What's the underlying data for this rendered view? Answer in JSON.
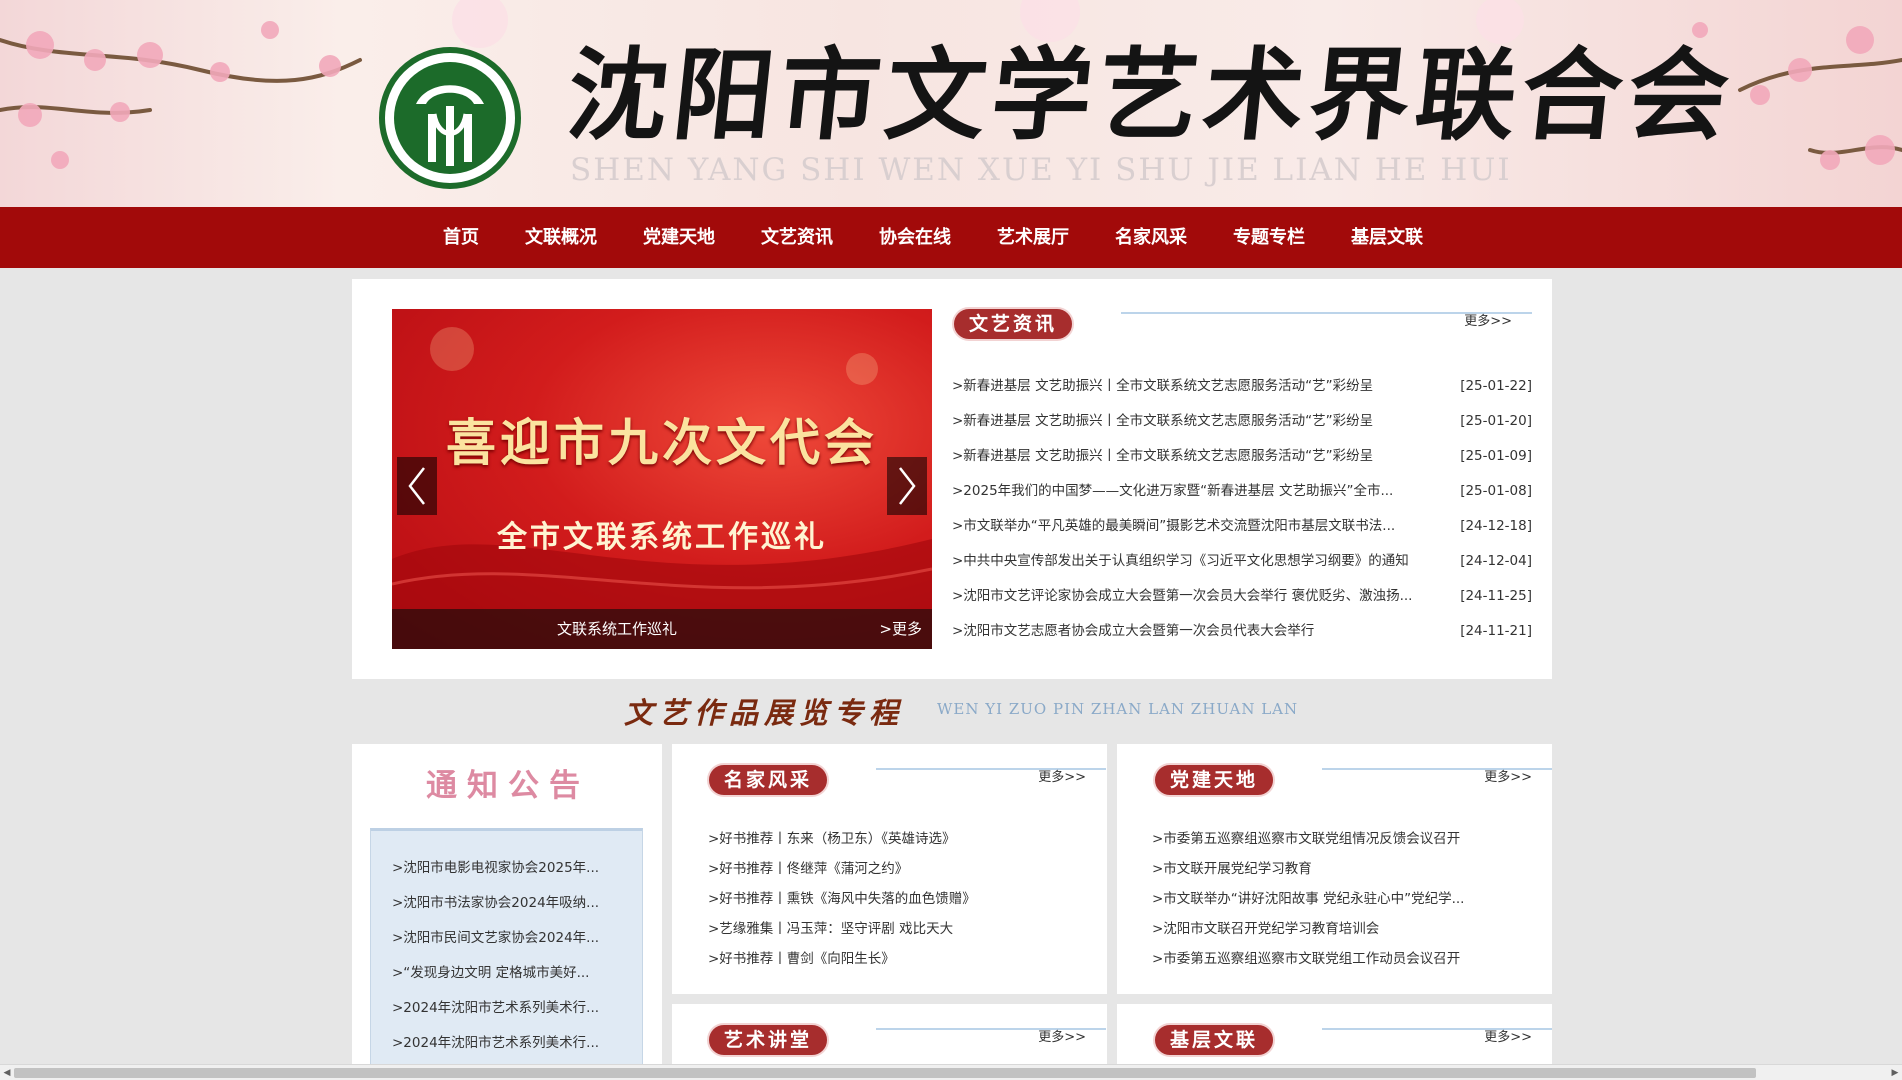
{
  "header": {
    "title": "沈阳市文学艺术界联合会",
    "pinyin": "SHEN YANG SHI WEN XUE YI SHU JIE LIAN HE HUI"
  },
  "nav": {
    "items": [
      "首页",
      "文联概况",
      "党建天地",
      "文艺资讯",
      "协会在线",
      "艺术展厅",
      "名家风采",
      "专题专栏",
      "基层文联"
    ]
  },
  "carousel": {
    "headline": "喜迎市九次文代会",
    "subline": "全市文联系统工作巡礼",
    "caption": "文联系统工作巡礼",
    "more": ">更多"
  },
  "news": {
    "tag": "文艺资讯",
    "more": "更多>>",
    "items": [
      {
        "title": ">新春进基层 文艺助振兴丨全市文联系统文艺志愿服务活动“艺”彩纷呈",
        "date": "[25-01-22]"
      },
      {
        "title": ">新春进基层 文艺助振兴丨全市文联系统文艺志愿服务活动“艺”彩纷呈",
        "date": "[25-01-20]"
      },
      {
        "title": ">新春进基层 文艺助振兴丨全市文联系统文艺志愿服务活动“艺”彩纷呈",
        "date": "[25-01-09]"
      },
      {
        "title": ">2025年我们的中国梦——文化进万家暨“新春进基层 文艺助振兴”全市...",
        "date": "[25-01-08]"
      },
      {
        "title": ">市文联举办“平凡英雄的最美瞬间”摄影艺术交流暨沈阳市基层文联书法...",
        "date": "[24-12-18]"
      },
      {
        "title": ">中共中央宣传部发出关于认真组织学习《习近平文化思想学习纲要》的通知",
        "date": "[24-12-04]"
      },
      {
        "title": ">沈阳市文艺评论家协会成立大会暨第一次会员大会举行 褒优贬劣、激浊扬...",
        "date": "[24-11-25]"
      },
      {
        "title": ">沈阳市文艺志愿者协会成立大会暨第一次会员代表大会举行",
        "date": "[24-11-21]"
      }
    ]
  },
  "showcase": {
    "title": "文艺作品展览专程",
    "pinyin": "WEN YI ZUO PIN ZHAN LAN ZHUAN LAN"
  },
  "notice": {
    "title": "通知公告",
    "items": [
      ">沈阳市电影电视家协会2025年...",
      ">沈阳市书法家协会2024年吸纳...",
      ">沈阳市民间文艺家协会2024年...",
      ">“发现身边文明 定格城市美好...",
      ">2024年沈阳市艺术系列美术行...",
      ">2024年沈阳市艺术系列美术行..."
    ]
  },
  "famous": {
    "tag": "名家风采",
    "more": "更多>>",
    "items": [
      ">好书推荐丨东来（杨卫东）《英雄诗选》",
      ">好书推荐丨佟继萍《蒲河之约》",
      ">好书推荐丨熏铁《海风中失落的血色馈赠》",
      ">艺缘雅集丨冯玉萍：坚守评剧 戏比天大",
      ">好书推荐丨曹剑《向阳生长》"
    ]
  },
  "party": {
    "tag": "党建天地",
    "more": "更多>>",
    "items": [
      ">市委第五巡察组巡察市文联党组情况反馈会议召开",
      ">市文联开展党纪学习教育",
      ">市文联举办“讲好沈阳故事 党纪永驻心中”党纪学...",
      ">沈阳市文联召开党纪学习教育培训会",
      ">市委第五巡察组巡察市文联党组工作动员会议召开"
    ]
  },
  "lecture": {
    "tag": "艺术讲堂",
    "more": "更多>>"
  },
  "grassroots": {
    "tag": "基层文联",
    "more": "更多>>"
  },
  "colors": {
    "nav_bg": "#a20a0a",
    "tag_bg": "#a72d2d",
    "notice_box": "#e0eaf4",
    "page_bg": "#e6e6e6"
  }
}
